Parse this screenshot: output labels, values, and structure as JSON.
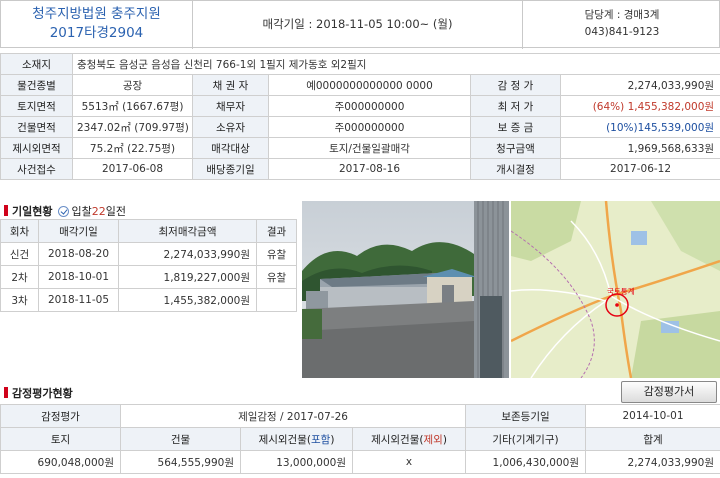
{
  "header": {
    "court": "청주지방법원 충주지원",
    "case_no": "2017타경2904",
    "sale_date": "매각기일 : 2018-11-05 10:00~ (월)",
    "dept": "담당계 : 경매3계",
    "phone": "043)841-9123"
  },
  "info": {
    "address_label": "소재지",
    "address": "충청북도 음성군 음성읍 신천리 766-1외 1필지 제가동호 외2필지",
    "rows": [
      [
        "물건종별",
        "공장",
        "채 권 자",
        "예0000000000000 0000",
        "감 정 가",
        "2,274,033,990원"
      ],
      [
        "토지면적",
        "5513㎡ (1667.67평)",
        "채무자",
        "주000000000",
        "최 저 가",
        "(64%) 1,455,382,000원"
      ],
      [
        "건물면적",
        "2347.02㎡ (709.97평)",
        "소유자",
        "주000000000",
        "보 증 금",
        "(10%)145,539,000원"
      ],
      [
        "제시외면적",
        "75.2㎡ (22.75평)",
        "매각대상",
        "토지/건물일괄매각",
        "청구금액",
        "1,969,568,633원"
      ],
      [
        "사건접수",
        "2017-06-08",
        "배당종기일",
        "2017-08-16",
        "개시결정",
        "2017-06-12"
      ]
    ]
  },
  "history": {
    "title": "기일현황",
    "badge": "입찰",
    "days": "22",
    "days_suffix": "일전",
    "headers": [
      "회차",
      "매각기일",
      "최저매각금액",
      "결과"
    ],
    "rows": [
      [
        "신건",
        "2018-08-20",
        "2,274,033,990원",
        "유찰"
      ],
      [
        "2차",
        "2018-10-01",
        "1,819,227,000원",
        "유찰"
      ],
      [
        "3차",
        "2018-11-05",
        "1,455,382,000원",
        ""
      ]
    ]
  },
  "map": {
    "marker": "국토통계"
  },
  "appraisal": {
    "title": "감정평가현황",
    "button": "감정평가서",
    "r1": [
      "감정평가",
      "제일감정 / 2017-07-26",
      "보존등기일",
      "2014-10-01"
    ],
    "headers": [
      "토지",
      "건물",
      "제시외건물(",
      "포함",
      ")",
      "제시외건물(",
      "제외",
      ")",
      "기타(기계기구)",
      "합계"
    ],
    "values": [
      "690,048,000원",
      "564,555,990원",
      "13,000,000원",
      "x",
      "1,006,430,000원",
      "2,274,033,990원"
    ]
  }
}
